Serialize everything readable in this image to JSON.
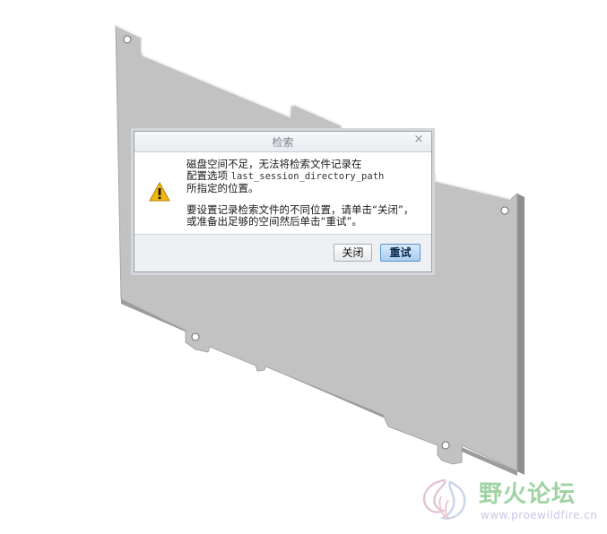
{
  "dialog": {
    "title": "检索",
    "close_glyph": "×",
    "icon": "warning-triangle-icon",
    "message_line1": "磁盘空间不足，无法将检索文件记录在",
    "message_line2_prefix": "配置选项",
    "message_option": "last_session_directory_path",
    "message_line3": "所指定的位置。",
    "message_line4": "要设置记录检索文件的不同位置，请单击“关闭”，",
    "message_line5": "或准备出足够的空间然后单击“重试”。",
    "close_button": "关闭",
    "retry_button": "重试"
  },
  "watermark": {
    "name": "野火论坛",
    "url": "www.proewildfire.cn"
  },
  "colors": {
    "part_face": "#c2c2c2",
    "part_edge": "#e6e6e6",
    "dialog_footer": "#eef0f3",
    "retry_button": "#a9cdf1",
    "warning": "#f2b70f"
  }
}
